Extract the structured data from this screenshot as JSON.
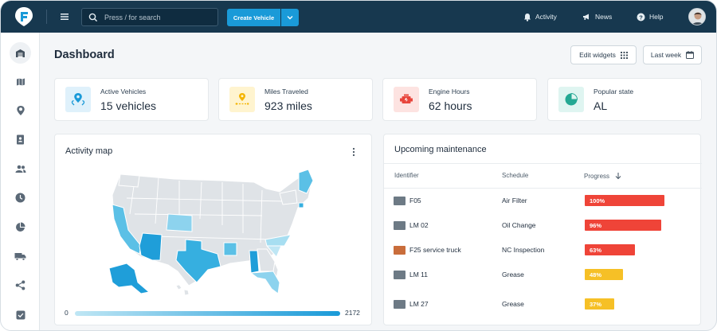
{
  "topbar": {
    "search_placeholder": "Press / for search",
    "create_button": "Create Vehicle",
    "links": [
      {
        "icon": "bell-icon",
        "label": "Activity"
      },
      {
        "icon": "megaphone-icon",
        "label": "News"
      },
      {
        "icon": "help-icon",
        "label": "Help"
      }
    ]
  },
  "sidebar": {
    "items": [
      "garage-icon",
      "map-icon",
      "location-pin-icon",
      "contacts-book-icon",
      "users-icon",
      "clock-icon",
      "pie-chart-icon",
      "truck-icon",
      "share-icon",
      "checklist-icon"
    ]
  },
  "page": {
    "title": "Dashboard",
    "edit_widgets": "Edit widgets",
    "date_range": "Last week"
  },
  "stats": [
    {
      "label": "Active Vehicles",
      "value": "15 vehicles",
      "icon": "vehicles-pin-icon",
      "bg": "#dff1fb",
      "fg": "#1a9ad8"
    },
    {
      "label": "Miles Traveled",
      "value": "923 miles",
      "icon": "route-pin-icon",
      "bg": "#fff4cf",
      "fg": "#f4b400"
    },
    {
      "label": "Engine Hours",
      "value": "62 hours",
      "icon": "engine-icon",
      "bg": "#fde3e1",
      "fg": "#e8453c"
    },
    {
      "label": "Popular state",
      "value": "AL",
      "icon": "pie-chart-icon",
      "bg": "#dff5f1",
      "fg": "#23a893"
    }
  ],
  "activity_map": {
    "title": "Activity map",
    "legend_min": "0",
    "legend_max": "2172",
    "colors": {
      "low": "#bfe6f4",
      "high": "#1a9ad8",
      "none": "#dfe3e7"
    }
  },
  "maintenance": {
    "title": "Upcoming maintenance",
    "headers": {
      "identifier": "Identifier",
      "schedule": "Schedule",
      "progress": "Progress"
    },
    "rows": [
      {
        "id": "F05",
        "schedule": "Air Filter",
        "progress": 100,
        "progress_label": "100%",
        "color": "#ef4438"
      },
      {
        "id": "LM 02",
        "schedule": "Oil Change",
        "progress": 96,
        "progress_label": "96%",
        "color": "#ef4438"
      },
      {
        "id": "F25 service truck",
        "schedule": "NC Inspection",
        "progress": 63,
        "progress_label": "63%",
        "color": "#ef4438"
      },
      {
        "id": "LM 11",
        "schedule": "Grease",
        "progress": 48,
        "progress_label": "48%",
        "color": "#f6c026"
      },
      {
        "id": "LM 27",
        "schedule": "Grease",
        "progress": 37,
        "progress_label": "37%",
        "color": "#f6c026"
      }
    ]
  }
}
